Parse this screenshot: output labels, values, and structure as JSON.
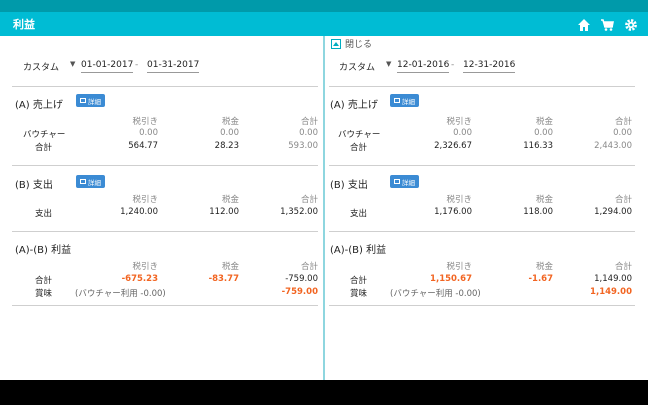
{
  "app": {
    "title": "利益",
    "icons": [
      "home-icon",
      "cart-icon",
      "gear-icon"
    ],
    "accent": "#00bcd4",
    "negative_color": "#f26522"
  },
  "headers": {
    "col1": "税引き",
    "col2": "税金",
    "col3": "合計"
  },
  "left": {
    "range": {
      "type": "カスタム",
      "start": "01-01-2017",
      "end": "01-31-2017"
    },
    "sales": {
      "title": "(A) 売上げ",
      "detail_label": "詳細",
      "rows": [
        {
          "label": "バウチャー",
          "net": "0.00",
          "tax": "0.00",
          "total": "0.00"
        },
        {
          "label": "合計",
          "net": "564.77",
          "tax": "28.23",
          "total": "593.00"
        }
      ]
    },
    "expenses": {
      "title": "(B) 支出",
      "detail_label": "詳細",
      "rows": [
        {
          "label": "支出",
          "net": "1,240.00",
          "tax": "112.00",
          "total": "1,352.00"
        }
      ]
    },
    "profit": {
      "title": "(A)-(B) 利益",
      "total": {
        "label": "合計",
        "net": "-675.23",
        "tax": "-83.77",
        "total": "-759.00"
      },
      "net": {
        "label": "賞味",
        "note": "(バウチャー利用 -0.00)",
        "total": "-759.00"
      }
    }
  },
  "right": {
    "close_label": "閉じる",
    "range": {
      "type": "カスタム",
      "start": "12-01-2016",
      "end": "12-31-2016"
    },
    "sales": {
      "title": "(A) 売上げ",
      "detail_label": "詳細",
      "rows": [
        {
          "label": "バウチャー",
          "net": "0.00",
          "tax": "0.00",
          "total": "0.00"
        },
        {
          "label": "合計",
          "net": "2,326.67",
          "tax": "116.33",
          "total": "2,443.00"
        }
      ]
    },
    "expenses": {
      "title": "(B) 支出",
      "detail_label": "詳細",
      "rows": [
        {
          "label": "支出",
          "net": "1,176.00",
          "tax": "118.00",
          "total": "1,294.00"
        }
      ]
    },
    "profit": {
      "title": "(A)-(B) 利益",
      "total": {
        "label": "合計",
        "net": "1,150.67",
        "tax": "-1.67",
        "total": "1,149.00"
      },
      "net": {
        "label": "賞味",
        "note": "(バウチャー利用 -0.00)",
        "total": "1,149.00"
      }
    }
  }
}
